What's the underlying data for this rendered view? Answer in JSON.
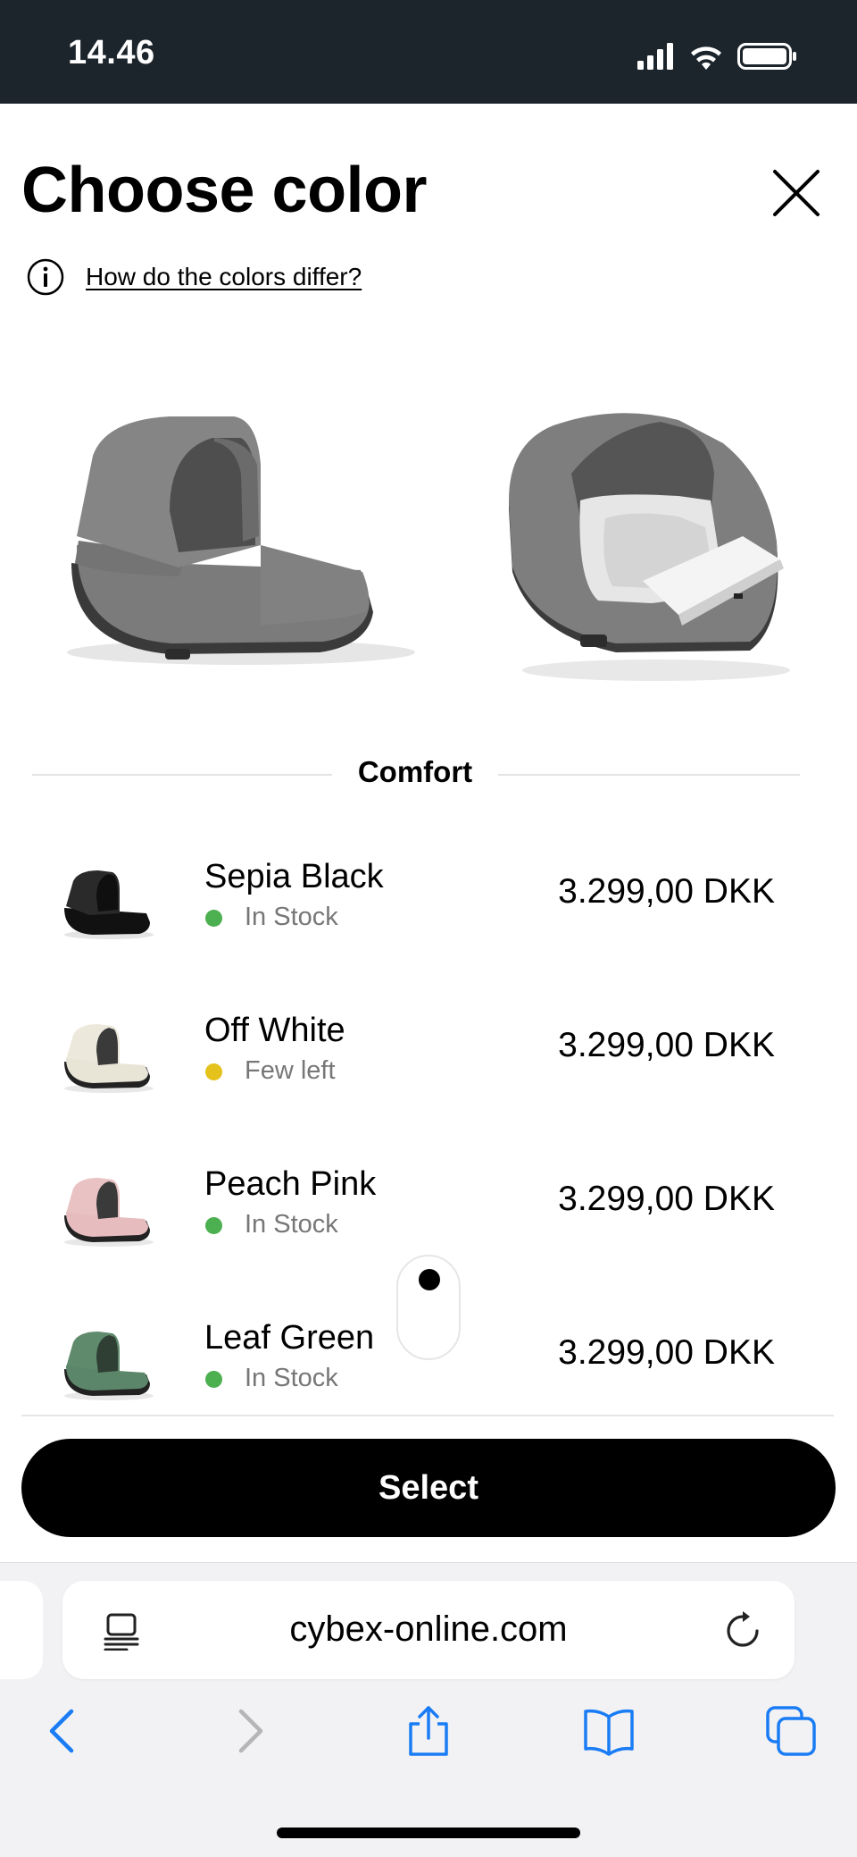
{
  "status_bar": {
    "time": "14.46",
    "icons": [
      "signal-icon",
      "wifi-icon",
      "battery-icon"
    ]
  },
  "header": {
    "title": "Choose color",
    "info_link": "How do the colors differ?",
    "icons": [
      "close-icon",
      "info-icon"
    ]
  },
  "section": {
    "title": "Comfort"
  },
  "colors": [
    {
      "name": "Sepia Black",
      "stock": "In Stock",
      "stock_color": "#4caf50",
      "price": "3.299,00 DKK",
      "swatch": "#2a2a2a"
    },
    {
      "name": "Off White",
      "stock": "Few left",
      "stock_color": "#e4c21b",
      "price": "3.299,00 DKK",
      "swatch": "#ece8dc"
    },
    {
      "name": "Peach Pink",
      "stock": "In Stock",
      "stock_color": "#4caf50",
      "price": "3.299,00 DKK",
      "swatch": "#e9c2c4"
    },
    {
      "name": "Leaf Green",
      "stock": "In Stock",
      "stock_color": "#4caf50",
      "price": "3.299,00 DKK",
      "swatch": "#5f8a6c"
    }
  ],
  "actions": {
    "select_label": "Select"
  },
  "browser": {
    "url": "cybex-online.com",
    "icons": [
      "reader-icon",
      "reload-icon",
      "back-icon",
      "forward-icon",
      "share-icon",
      "bookmarks-icon",
      "tabs-icon"
    ]
  },
  "theme": {
    "status_bar_bg": "#1c252c",
    "accent": "#000000",
    "browser_blue": "#1a7cf5"
  }
}
